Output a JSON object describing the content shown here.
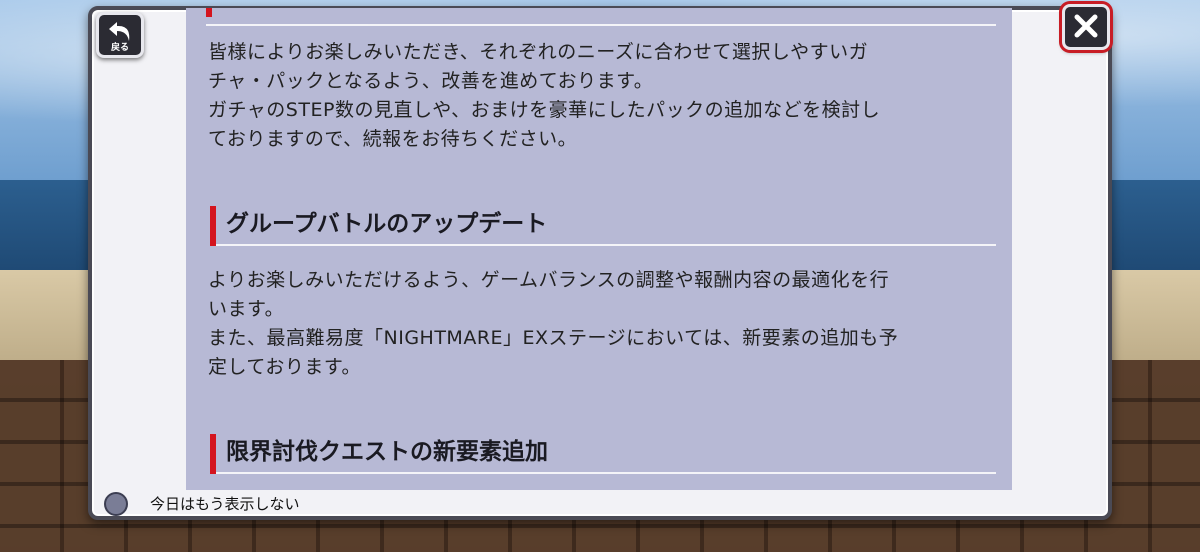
{
  "dialog": {
    "back_label": "戻る",
    "sections": [
      {
        "paragraph": [
          "皆様によりお楽しみいただき、それぞれのニーズに合わせて選択しやすいガ",
          "チャ・パックとなるよう、改善を進めております。",
          "ガチャのSTEP数の見直しや、おまけを豪華にしたパックの追加などを検討し",
          "ておりますので、続報をお待ちください。"
        ]
      },
      {
        "heading": "グループバトルのアップデート",
        "paragraph": [
          "よりお楽しみいただけるよう、ゲームバランスの調整や報酬内容の最適化を行",
          "います。",
          "また、最高難易度「NIGHTMARE」EXステージにおいては、新要素の追加も予",
          "定しております。"
        ]
      },
      {
        "heading": "限界討伐クエストの新要素追加"
      }
    ]
  },
  "footer": {
    "dont_show_today_label": "今日はもう表示しない",
    "checkbox_checked": false
  },
  "colors": {
    "panel": "#b7b9d5",
    "accent_red": "#d4141e",
    "frame": "#4a4a55"
  },
  "icons": {
    "back": "back-arrow-icon",
    "close": "close-icon"
  }
}
